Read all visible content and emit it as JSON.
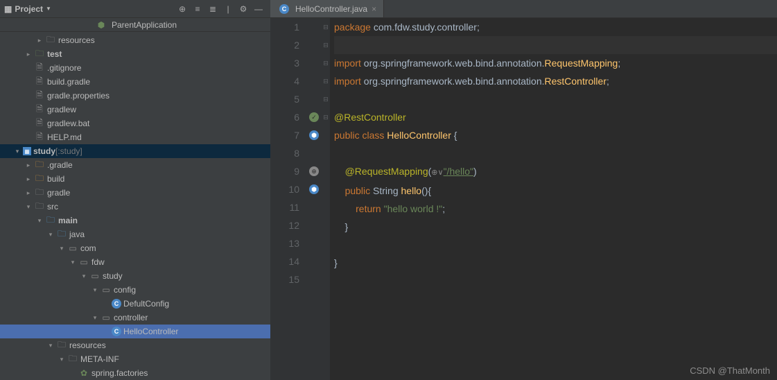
{
  "sidebar": {
    "title": "Project",
    "parent_app": "ParentApplication",
    "tree": [
      {
        "indent": 2,
        "arrow": ">",
        "iconType": "folder",
        "label": "resources"
      },
      {
        "indent": 1,
        "arrow": ">",
        "iconType": "folder-green",
        "label": "test",
        "bold": true
      },
      {
        "indent": 1,
        "arrow": "",
        "iconType": "file",
        "label": ".gitignore"
      },
      {
        "indent": 1,
        "arrow": "",
        "iconType": "file",
        "label": "build.gradle"
      },
      {
        "indent": 1,
        "arrow": "",
        "iconType": "file",
        "label": "gradle.properties"
      },
      {
        "indent": 1,
        "arrow": "",
        "iconType": "file",
        "label": "gradlew"
      },
      {
        "indent": 1,
        "arrow": "",
        "iconType": "file",
        "label": "gradlew.bat"
      },
      {
        "indent": 1,
        "arrow": "",
        "iconType": "file",
        "label": "HELP.md"
      },
      {
        "indent": 0,
        "arrow": "v",
        "iconType": "module",
        "label": "study",
        "suffix": "[:study]",
        "bold": true,
        "highlighted": true
      },
      {
        "indent": 1,
        "arrow": ">",
        "iconType": "folder-orange",
        "label": ".gradle"
      },
      {
        "indent": 1,
        "arrow": ">",
        "iconType": "folder-orange",
        "label": "build"
      },
      {
        "indent": 1,
        "arrow": ">",
        "iconType": "folder",
        "label": "gradle"
      },
      {
        "indent": 1,
        "arrow": "v",
        "iconType": "folder",
        "label": "src"
      },
      {
        "indent": 2,
        "arrow": "v",
        "iconType": "folder-blue",
        "label": "main",
        "bold": true
      },
      {
        "indent": 3,
        "arrow": "v",
        "iconType": "folder-blue",
        "label": "java"
      },
      {
        "indent": 4,
        "arrow": "v",
        "iconType": "pkg",
        "label": "com"
      },
      {
        "indent": 5,
        "arrow": "v",
        "iconType": "pkg",
        "label": "fdw"
      },
      {
        "indent": 6,
        "arrow": "v",
        "iconType": "pkg",
        "label": "study"
      },
      {
        "indent": 7,
        "arrow": "v",
        "iconType": "pkg",
        "label": "config"
      },
      {
        "indent": 8,
        "arrow": "",
        "iconType": "class",
        "label": "DefultConfig"
      },
      {
        "indent": 7,
        "arrow": "v",
        "iconType": "pkg",
        "label": "controller"
      },
      {
        "indent": 8,
        "arrow": "",
        "iconType": "class",
        "label": "HelloController",
        "selected": true
      },
      {
        "indent": 3,
        "arrow": "v",
        "iconType": "folder-res",
        "label": "resources"
      },
      {
        "indent": 4,
        "arrow": "v",
        "iconType": "folder",
        "label": "META-INF"
      },
      {
        "indent": 5,
        "arrow": "",
        "iconType": "spring",
        "label": "spring.factories"
      }
    ]
  },
  "tabs": [
    {
      "icon": "class",
      "label": "HelloController.java",
      "active": true
    }
  ],
  "code": {
    "lines": [
      {
        "n": 1,
        "html": "<span class='kw'>package</span> <span class='pkg'>com.fdw.study.controller;</span>"
      },
      {
        "n": 2,
        "html": "<span class='filetop-hl'>&nbsp;</span>",
        "cursor": true
      },
      {
        "n": 3,
        "fold": "⊟",
        "html": "<span class='kw'>import</span> <span class='pkg'>org.springframework.web.bind.annotation.</span><span class='cls'>RequestMapping</span>;"
      },
      {
        "n": 4,
        "fold": "⊟",
        "html": "<span class='kw'>import</span> <span class='pkg'>org.springframework.web.bind.annotation.</span><span class='cls'>RestController</span>;"
      },
      {
        "n": 5,
        "html": ""
      },
      {
        "n": 6,
        "marker": "spring-green",
        "html": "<span class='ann'>@RestController</span>"
      },
      {
        "n": 7,
        "marker": "spring-blue",
        "fold": "⊟",
        "html": "<span class='kw'>public class</span> <span class='cls'>HelloController</span> {"
      },
      {
        "n": 8,
        "html": ""
      },
      {
        "n": 9,
        "marker": "web",
        "html": "    <span class='ann'>@RequestMapping</span>(<span class='gl-icon'>⊕∨</span><span class='str underl'>\"/hello\"</span>)"
      },
      {
        "n": 10,
        "marker": "spring-blue",
        "fold": "⊟",
        "html": "    <span class='kw'>public</span> String <span class='cls'>hello</span>(){"
      },
      {
        "n": 11,
        "html": "        <span class='kw'>return</span> <span class='str'>\"hello world !\"</span>;"
      },
      {
        "n": 12,
        "fold": "⊟",
        "html": "    }"
      },
      {
        "n": 13,
        "html": ""
      },
      {
        "n": 14,
        "fold": "⊟",
        "html": "}"
      },
      {
        "n": 15,
        "html": ""
      }
    ]
  },
  "watermark": "CSDN @ThatMonth"
}
